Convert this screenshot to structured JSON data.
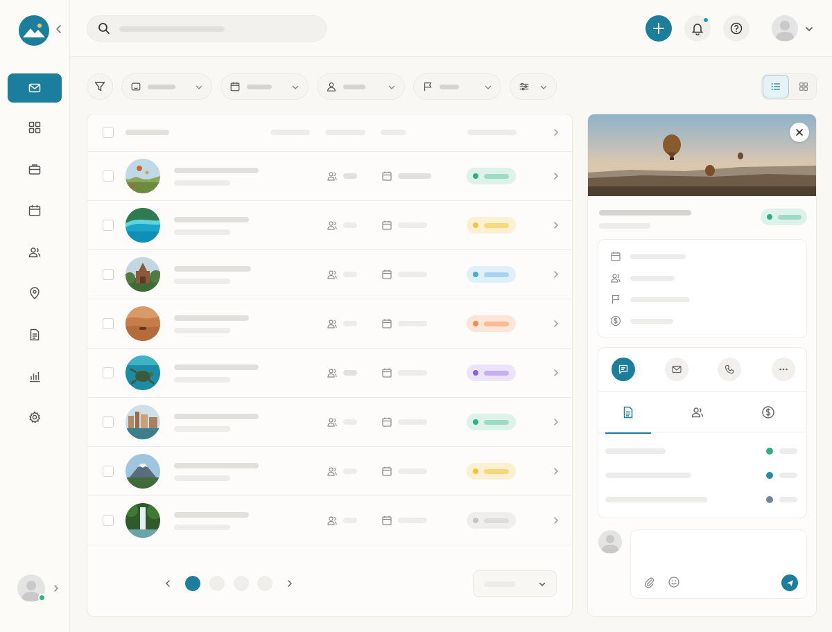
{
  "app": {
    "title": ""
  },
  "search": {
    "placeholder": "",
    "value": ""
  },
  "composer": {
    "placeholder": "",
    "value": ""
  },
  "colors": {
    "primary": "#1b7e9c",
    "green": "#2eb67d",
    "yellow": "#f5c341",
    "blue": "#5ab0e0",
    "orange": "#f59a5c",
    "purple": "#9a72e0",
    "gray": "#b9b9b9"
  },
  "sidebar": {
    "items": [
      {
        "icon": "mail-icon",
        "active": true
      },
      {
        "icon": "grid-icon",
        "active": false
      },
      {
        "icon": "briefcase-icon",
        "active": false
      },
      {
        "icon": "calendar-icon",
        "active": false
      },
      {
        "icon": "users-icon",
        "active": false
      },
      {
        "icon": "map-pin-icon",
        "active": false
      },
      {
        "icon": "document-icon",
        "active": false
      },
      {
        "icon": "bar-chart-icon",
        "active": false
      },
      {
        "icon": "settings-icon",
        "active": false
      }
    ]
  },
  "filters": [
    {
      "icon": "category-icon"
    },
    {
      "icon": "calendar-icon"
    },
    {
      "icon": "user-icon"
    },
    {
      "icon": "flag-icon"
    },
    {
      "icon": "sliders-icon"
    }
  ],
  "table": {
    "rows": [
      {
        "image": "balloons-landscape",
        "status_color": "green"
      },
      {
        "image": "tropical-coast",
        "status_color": "yellow"
      },
      {
        "image": "temple",
        "status_color": "blue"
      },
      {
        "image": "desert-camel",
        "status_color": "orange"
      },
      {
        "image": "sea-turtle",
        "status_color": "purple"
      },
      {
        "image": "waterfront-city",
        "status_color": "green"
      },
      {
        "image": "volcano",
        "status_color": "yellow"
      },
      {
        "image": "jungle-waterfall",
        "status_color": "gray"
      }
    ]
  },
  "pagination": {
    "pages": 4,
    "current": 1
  },
  "detail": {
    "hero": "hot-air-balloons-sunrise",
    "status_color": "green",
    "info_rows": [
      "calendar-icon",
      "users-icon",
      "flag-icon",
      "dollar-icon"
    ],
    "actions": [
      "message-icon",
      "mail-icon",
      "phone-icon",
      "more-icon"
    ],
    "tabs": [
      "document-icon",
      "users-icon",
      "dollar-icon"
    ],
    "list_dots": [
      "#2eae84",
      "#1f8ea3",
      "#6b8796"
    ]
  }
}
